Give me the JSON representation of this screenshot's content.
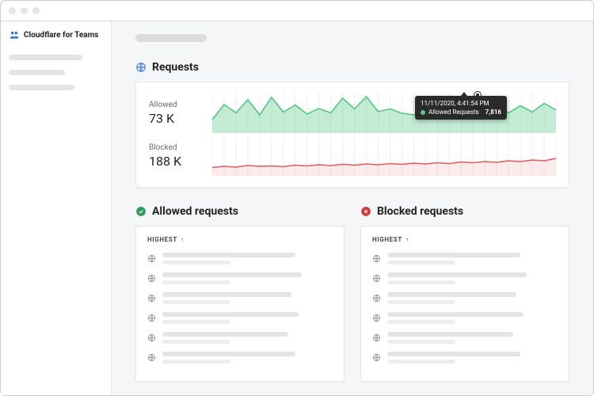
{
  "brand": {
    "name": "Cloudflare for Teams"
  },
  "sections": {
    "requests": {
      "title": "Requests"
    },
    "allowed": {
      "title": "Allowed requests"
    },
    "blocked": {
      "title": "Blocked requests"
    }
  },
  "metrics": {
    "allowed": {
      "label": "Allowed",
      "value": "73 K"
    },
    "blocked": {
      "label": "Blocked",
      "value": "188 K"
    }
  },
  "tooltip": {
    "timestamp": "11/11/2020, 4:41:54 PM",
    "series_label": "Allowed Requests",
    "value": "7,816"
  },
  "list_header": {
    "sort_label": "HIGHEST"
  },
  "chart_data": [
    {
      "type": "area",
      "name": "Allowed",
      "ylim": [
        0,
        10000
      ],
      "values": [
        3400,
        7200,
        5100,
        8400,
        4600,
        9000,
        5300,
        7100,
        4800,
        6200,
        5100,
        8800,
        6100,
        9200,
        5400,
        6100,
        5000,
        4600,
        5600,
        4700,
        7800,
        5300,
        7800,
        5800,
        7200,
        5100,
        6900,
        5300,
        7500,
        5800
      ],
      "color": "#57c886"
    },
    {
      "type": "area",
      "name": "Blocked",
      "ylim": [
        0,
        10000
      ],
      "values": [
        2100,
        2400,
        2200,
        2600,
        2400,
        2500,
        2300,
        2700,
        2500,
        2800,
        2600,
        2900,
        2700,
        3000,
        2800,
        3100,
        2900,
        3200,
        3000,
        3300,
        3100,
        3500,
        3300,
        3600,
        3400,
        3800,
        3600,
        4000,
        3800,
        4400
      ],
      "color": "#e45a5a"
    }
  ]
}
